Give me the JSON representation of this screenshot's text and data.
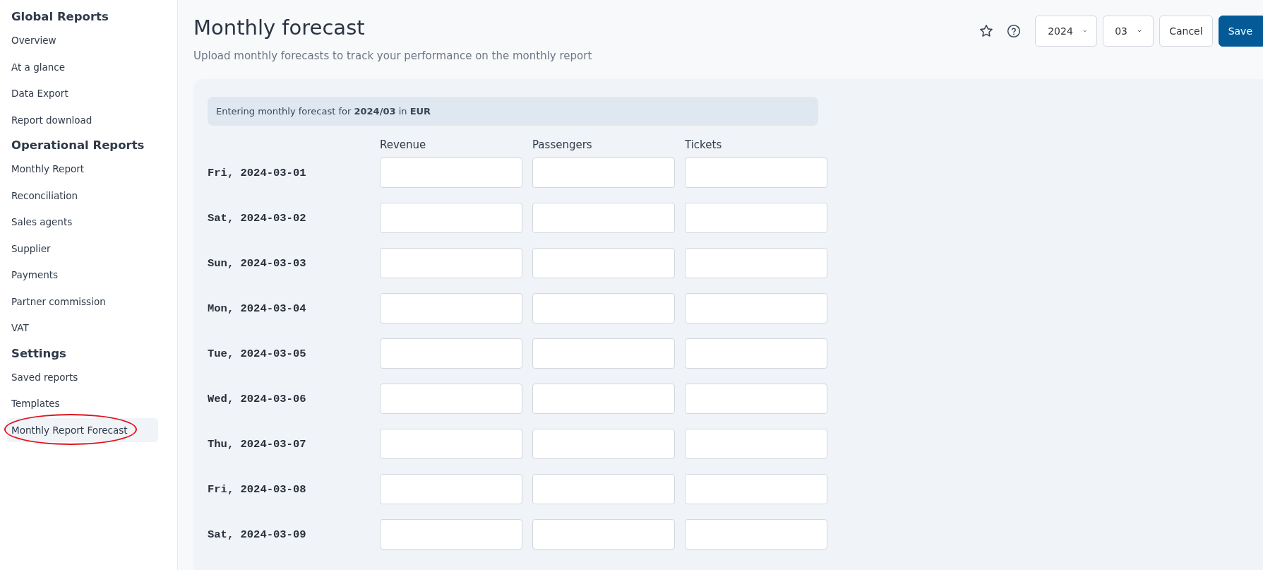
{
  "sidebar": {
    "sections": [
      {
        "heading": "Global Reports",
        "items": [
          {
            "label": "Overview",
            "selected": false,
            "circled": false
          },
          {
            "label": "At a glance",
            "selected": false,
            "circled": false
          },
          {
            "label": "Data Export",
            "selected": false,
            "circled": false
          },
          {
            "label": "Report download",
            "selected": false,
            "circled": false
          }
        ]
      },
      {
        "heading": "Operational Reports",
        "items": [
          {
            "label": "Monthly Report",
            "selected": false,
            "circled": false
          },
          {
            "label": "Reconciliation",
            "selected": false,
            "circled": false
          },
          {
            "label": "Sales agents",
            "selected": false,
            "circled": false
          },
          {
            "label": "Supplier",
            "selected": false,
            "circled": false
          },
          {
            "label": "Payments",
            "selected": false,
            "circled": false
          },
          {
            "label": "Partner commission",
            "selected": false,
            "circled": false
          },
          {
            "label": "VAT",
            "selected": false,
            "circled": false
          }
        ]
      },
      {
        "heading": "Settings",
        "items": [
          {
            "label": "Saved reports",
            "selected": false,
            "circled": false
          },
          {
            "label": "Templates",
            "selected": false,
            "circled": false
          },
          {
            "label": "Monthly Report Forecast",
            "selected": true,
            "circled": true
          }
        ]
      }
    ]
  },
  "header": {
    "title": "Monthly forecast",
    "subtitle": "Upload monthly forecasts to track your performance on the monthly report",
    "year": "2024",
    "month": "03",
    "cancel": "Cancel",
    "save": "Save"
  },
  "banner": "Entering monthly forecast for **2024/03** in **EUR**",
  "columns": [
    "Revenue",
    "Passengers",
    "Tickets"
  ],
  "rows": [
    {
      "date": "Fri, 2024-03-01"
    },
    {
      "date": "Sat, 2024-03-02"
    },
    {
      "date": "Sun, 2024-03-03"
    },
    {
      "date": "Mon, 2024-03-04"
    },
    {
      "date": "Tue, 2024-03-05"
    },
    {
      "date": "Wed, 2024-03-06"
    },
    {
      "date": "Thu, 2024-03-07"
    },
    {
      "date": "Fri, 2024-03-08"
    },
    {
      "date": "Sat, 2024-03-09"
    }
  ]
}
